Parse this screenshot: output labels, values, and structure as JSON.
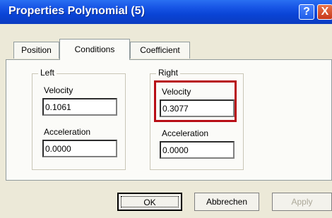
{
  "window": {
    "title": "Properties Polynomial (5)",
    "help_glyph": "?",
    "close_glyph": "X"
  },
  "tabs": [
    {
      "label": "Position",
      "active": false
    },
    {
      "label": "Conditions",
      "active": true
    },
    {
      "label": "Coefficient",
      "active": false
    }
  ],
  "left": {
    "legend": "Left",
    "velocity_label": "Velocity",
    "velocity_value": "0.1061",
    "acceleration_label": "Acceleration",
    "acceleration_value": "0.0000"
  },
  "right": {
    "legend": "Right",
    "velocity_label": "Velocity",
    "velocity_value": "0.3077",
    "acceleration_label": "Acceleration",
    "acceleration_value": "0.0000"
  },
  "buttons": {
    "ok": "OK",
    "cancel": "Abbrechen",
    "apply": "Apply"
  },
  "colors": {
    "highlight": "#b80e16",
    "titlebar": "#0a44d6"
  }
}
